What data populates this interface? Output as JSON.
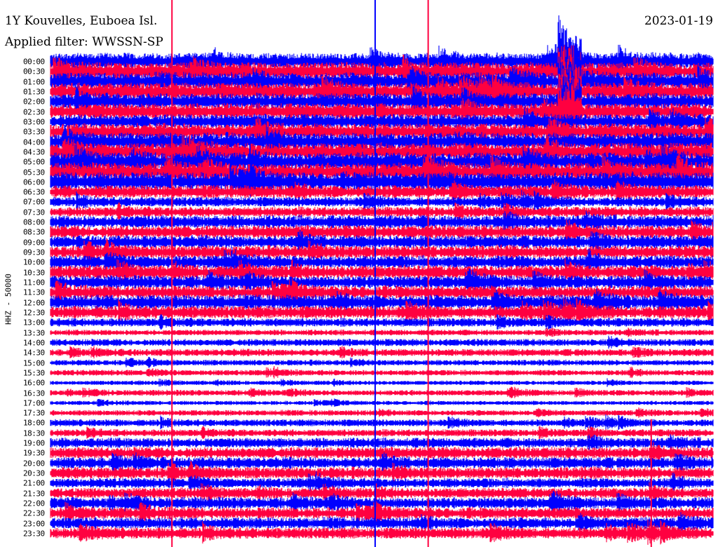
{
  "header": {
    "station": "1Y Kouvelles, Euboea Isl.",
    "filter": "Applied filter: WWSSN-SP",
    "date": "2023-01-19"
  },
  "chart_data": {
    "type": "line",
    "title": "1Y Kouvelles, Euboea Isl.",
    "ylabel": "HHZ - 50000",
    "colors": [
      "#0000ff",
      "#ff0040"
    ],
    "rows": [
      "00:00",
      "00:30",
      "01:00",
      "01:30",
      "02:00",
      "02:30",
      "03:00",
      "03:30",
      "04:00",
      "04:30",
      "05:00",
      "05:30",
      "06:00",
      "06:30",
      "07:00",
      "07:30",
      "08:00",
      "08:30",
      "09:00",
      "09:30",
      "10:00",
      "10:30",
      "11:00",
      "11:30",
      "12:00",
      "12:30",
      "13:00",
      "13:30",
      "14:00",
      "14:30",
      "15:00",
      "15:30",
      "16:00",
      "16:30",
      "17:00",
      "17:30",
      "18:00",
      "18:30",
      "19:00",
      "19:30",
      "20:00",
      "20:30",
      "21:00",
      "21:30",
      "22:00",
      "22:30",
      "23:00",
      "23:30"
    ],
    "relative_amplitude": [
      11,
      12,
      12,
      12,
      11,
      11,
      10,
      11,
      12,
      12,
      12,
      12,
      13,
      9,
      7,
      7,
      9,
      9,
      9,
      9,
      9,
      9,
      9,
      9,
      10,
      9,
      6,
      4,
      5,
      5,
      4,
      4,
      3,
      4,
      3,
      4,
      5,
      5,
      7,
      8,
      8,
      8,
      7,
      7,
      8,
      8,
      8,
      8
    ],
    "spikes_minutes": [
      {
        "row_start": 0,
        "row_end": 47,
        "minute": 5.5,
        "color": "#ff0040"
      },
      {
        "row_start": 0,
        "row_end": 47,
        "minute": 14.7,
        "color": "#0000ff"
      },
      {
        "row_start": 0,
        "row_end": 47,
        "minute": 17.1,
        "color": "#ff0040"
      },
      {
        "row_start": 37,
        "row_end": 47,
        "minute": 27.2,
        "color": "#ff0040"
      }
    ]
  }
}
